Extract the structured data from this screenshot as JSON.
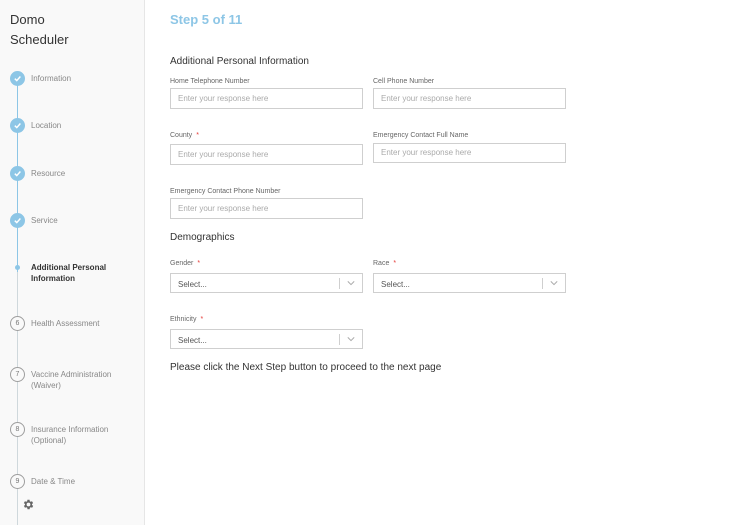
{
  "app": {
    "title_line1": "Domo",
    "title_line2": "Scheduler"
  },
  "steps": [
    {
      "label": "Information",
      "state": "done",
      "icon": "check-icon"
    },
    {
      "label": "Location",
      "state": "done",
      "icon": "check-icon"
    },
    {
      "label": "Resource",
      "state": "done",
      "icon": "check-icon"
    },
    {
      "label": "Service",
      "state": "done",
      "icon": "check-icon"
    },
    {
      "label": "Additional Personal Information",
      "state": "current"
    },
    {
      "label": "Health Assessment",
      "state": "pending",
      "number": "6"
    },
    {
      "label": "Vaccine Administration (Waiver)",
      "state": "pending",
      "number": "7"
    },
    {
      "label": "Insurance Information (Optional)",
      "state": "pending",
      "number": "8"
    },
    {
      "label": "Date & Time",
      "state": "pending",
      "number": "9"
    }
  ],
  "header": {
    "step_count": "Step 5 of 11"
  },
  "form": {
    "section1": "Additional Personal Information",
    "home_phone": {
      "label": "Home Telephone Number",
      "placeholder": "Enter your response here"
    },
    "cell_phone": {
      "label": "Cell Phone Number",
      "placeholder": "Enter your response here"
    },
    "county": {
      "label": "County",
      "required": "*",
      "placeholder": "Enter your response here"
    },
    "emergency_name": {
      "label": "Emergency Contact Full Name",
      "placeholder": "Enter your response here"
    },
    "emergency_phone": {
      "label": "Emergency Contact Phone Number",
      "placeholder": "Enter your response here"
    },
    "section2": "Demographics",
    "gender": {
      "label": "Gender",
      "required": "*",
      "value": "Select..."
    },
    "race": {
      "label": "Race",
      "required": "*",
      "value": "Select..."
    },
    "ethnicity": {
      "label": "Ethnicity",
      "required": "*",
      "value": "Select..."
    }
  },
  "note": "Please click the Next Step button to proceed to the next page",
  "colors": {
    "accent": "#8dc6e6",
    "required": "#e53935"
  }
}
